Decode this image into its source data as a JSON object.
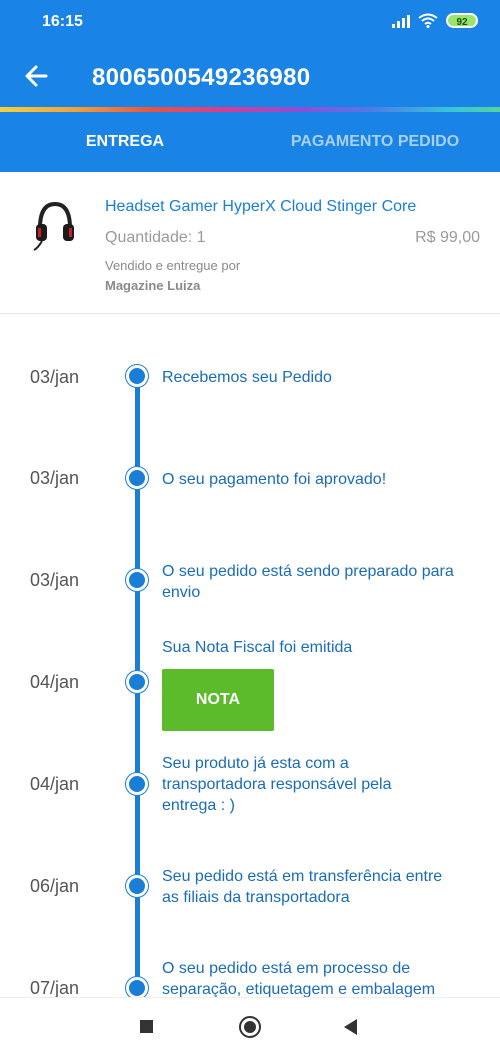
{
  "status_bar": {
    "time": "16:15",
    "battery": "92"
  },
  "app_bar": {
    "order_number": "8006500549236980"
  },
  "tabs": [
    {
      "label": "ENTREGA",
      "active": true
    },
    {
      "label": "PAGAMENTO PEDIDO",
      "active": false
    }
  ],
  "product": {
    "name": "Headset Gamer HyperX Cloud Stinger Core",
    "quantity": "Quantidade: 1",
    "price": "R$ 99,00",
    "sold_by_label": "Vendido e entregue por",
    "seller": "Magazine Luiza"
  },
  "timeline": {
    "events": [
      {
        "date": "03/jan",
        "text": "Recebemos seu Pedido"
      },
      {
        "date": "03/jan",
        "text": "O seu pagamento foi aprovado!"
      },
      {
        "date": "03/jan",
        "text": "O seu pedido está sendo preparado para envio"
      },
      {
        "date": "04/jan",
        "text": "Sua Nota Fiscal foi emitida",
        "button": "NOTA"
      },
      {
        "date": "04/jan",
        "text": "Seu produto já esta com a transportadora responsável pela entrega : )"
      },
      {
        "date": "06/jan",
        "text": "Seu pedido está em transferência entre as filiais da transportadora"
      },
      {
        "date": "07/jan",
        "text": "O seu pedido está em processo de separação, etiquetagem e embalagem"
      }
    ]
  },
  "colors": {
    "primary": "#1a83e6",
    "timeline": "#1a7ed6",
    "button": "#5bbb2b"
  }
}
